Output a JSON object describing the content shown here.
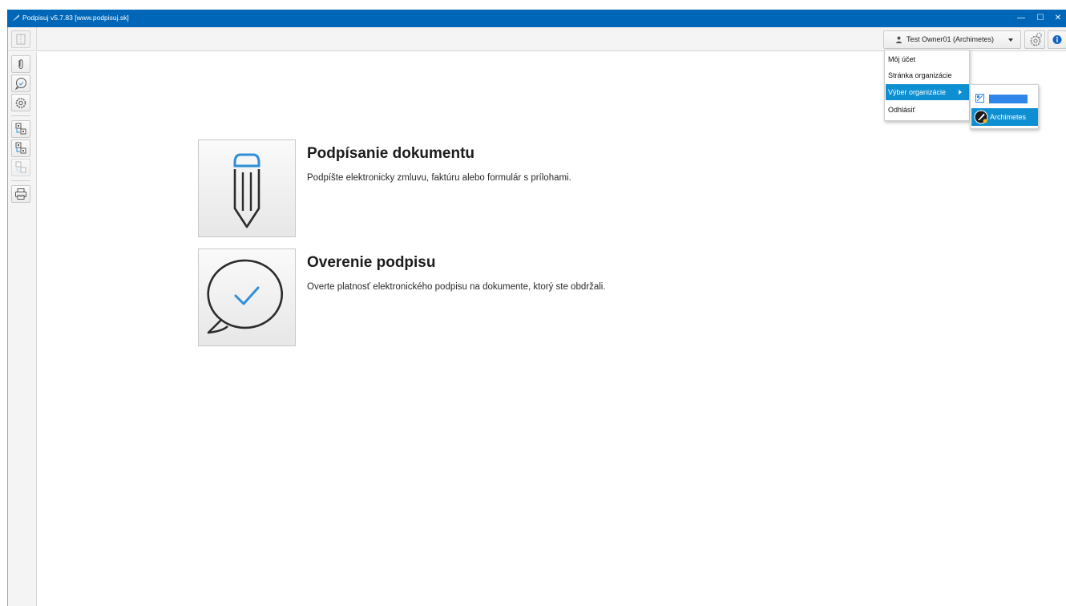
{
  "window": {
    "title": "Podpisuj v5.7.83 [www.podpisuj.sk]",
    "minimize_symbol": "—",
    "maximize_symbol": "☐",
    "close_symbol": "✕"
  },
  "toolbar": {
    "user_label": "Test Owner01 (Archimetes)"
  },
  "user_menu": {
    "items": [
      {
        "label": "Môj účet"
      },
      {
        "label": "Stránka organizácie"
      },
      {
        "label": "Výber organizácie"
      },
      {
        "label": "Odhlásiť"
      }
    ],
    "submenu": {
      "items": [
        {
          "label": ""
        },
        {
          "label": "Archimetes"
        }
      ]
    }
  },
  "main": {
    "sign": {
      "title": "Podpísanie dokumentu",
      "description": "Podpíšte elektronicky zmluvu, faktúru alebo formulár s prílohami."
    },
    "verify": {
      "title": "Overenie podpisu",
      "description": "Overte platnosť elektronického podpisu na dokumente, ktorý ste obdržali."
    }
  },
  "colors": {
    "titlebar": "#0067b8",
    "menu_highlight": "#0e8fd1",
    "icon_accent": "#2f8fd6",
    "info_blue": "#1565c0"
  }
}
